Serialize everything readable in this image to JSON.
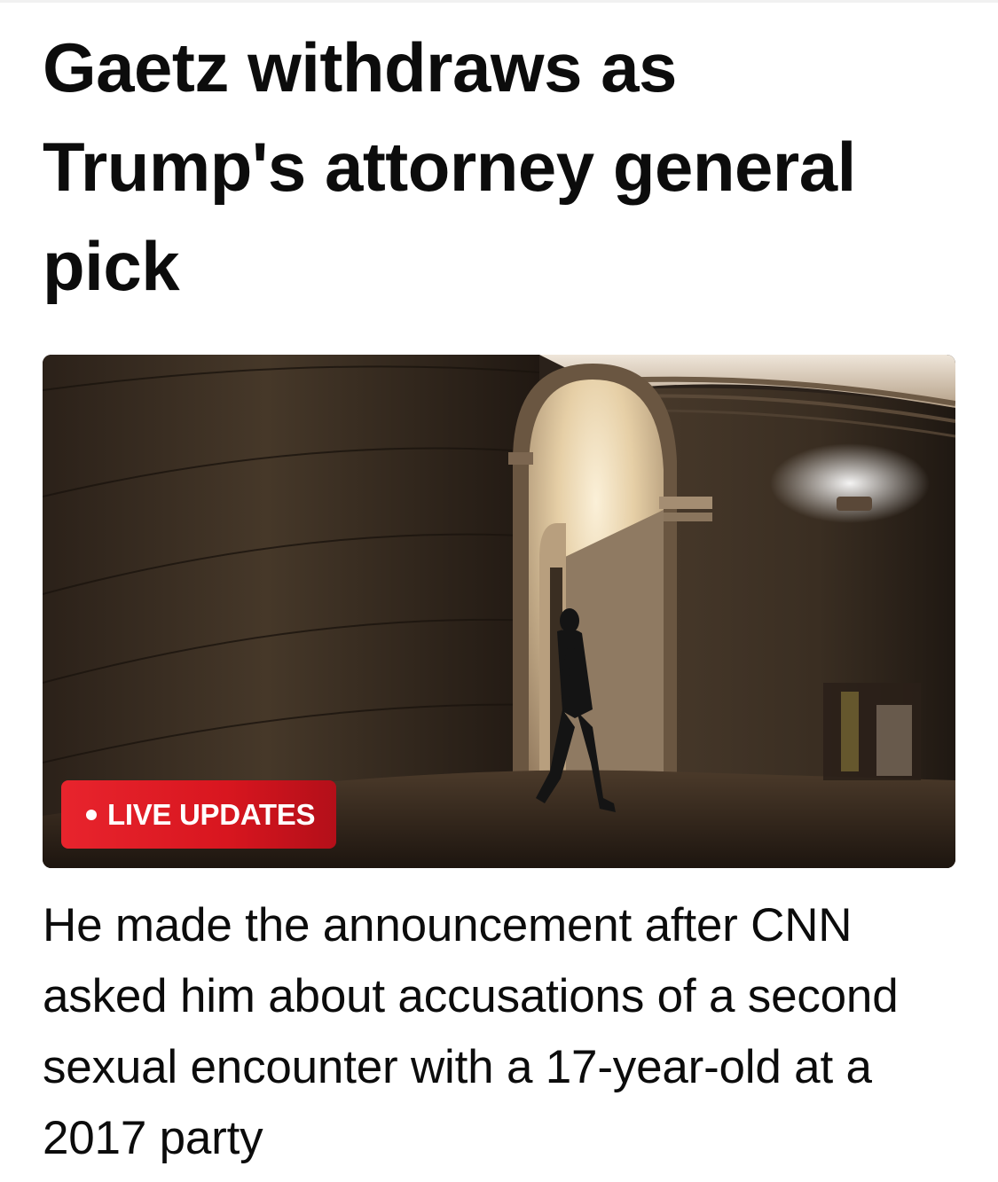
{
  "article": {
    "headline": "Gaetz withdraws as Trump's attorney general pick",
    "badge_label": "LIVE UPDATES",
    "description": "He made the announcement after CNN asked him about accusations of a second sexual encounter with a 17-year-old at a 2017 party"
  },
  "colors": {
    "badge_red": "#e8242d",
    "text": "#0c0c0c",
    "background": "#ffffff"
  }
}
